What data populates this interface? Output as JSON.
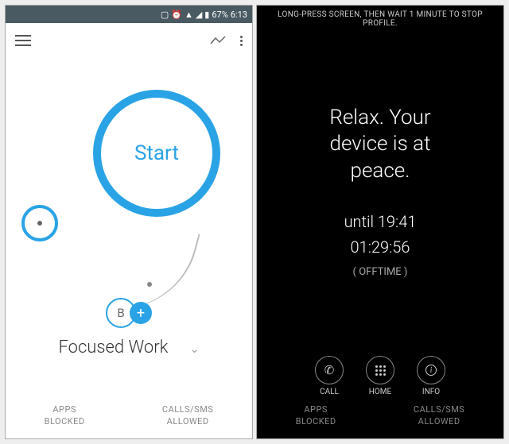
{
  "status": {
    "battery": "67%",
    "time": "6:13"
  },
  "left": {
    "start_label": "Start",
    "chip_letter": "B",
    "chip_plus": "+",
    "profile_name": "Focused Work",
    "footer_blocked_l1": "APPS",
    "footer_blocked_l2": "BLOCKED",
    "footer_allowed_l1": "CALLS/SMS",
    "footer_allowed_l2": "ALLOWED"
  },
  "right": {
    "hint": "LONG-PRESS SCREEN, THEN WAIT 1 MINUTE TO STOP PROFILE.",
    "message_l1": "Relax. Your",
    "message_l2": "device is at",
    "message_l3": "peace.",
    "until": "until 19:41",
    "countdown": "01:29:56",
    "offtime": "(  OFFTIME  )",
    "action_call": "CALL",
    "action_home": "HOME",
    "action_info": "INFO",
    "footer_blocked_l1": "APPS",
    "footer_blocked_l2": "BLOCKED",
    "footer_allowed_l1": "CALLS/SMS",
    "footer_allowed_l2": "ALLOWED"
  }
}
